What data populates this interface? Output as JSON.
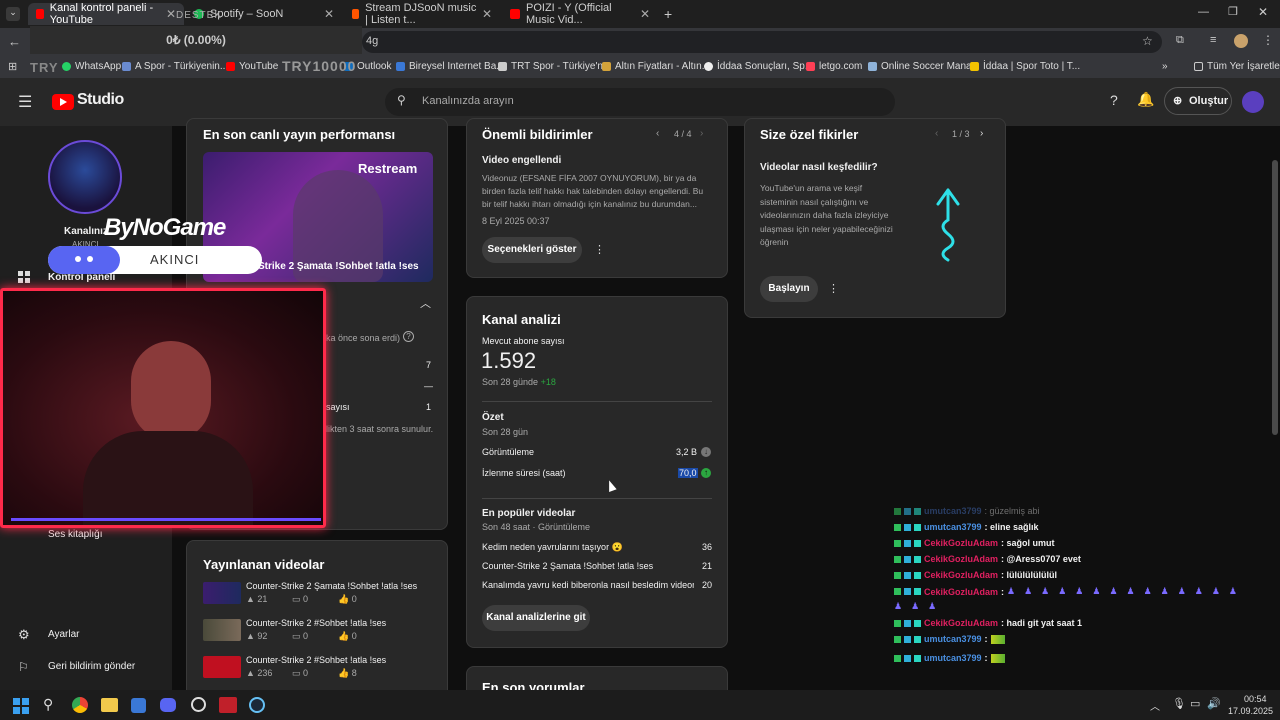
{
  "browser": {
    "tabs": [
      {
        "title": "Kanal kontrol paneli - YouTube",
        "active": true
      },
      {
        "title": "Spotify – SooN"
      },
      {
        "title": "Stream DJSooN music | Listen t..."
      },
      {
        "title": "POIZI - Y (Official Music Vid..."
      }
    ],
    "address_fragment": "4g",
    "bookmarks": [
      "WhatsApp",
      "A Spor - Türkiyenin...",
      "YouTube",
      "Outlook",
      "Bireysel Internet Ba...",
      "TRT Spor - Türkiye'n...",
      "Altın Fiyatları - Altın...",
      "İddaa Sonuçları, Sp...",
      "letgo.com",
      "Online Soccer Mana...",
      "İddaa | Spor Toto | T..."
    ],
    "all_bookmarks": "Tüm Yer İşaretleri"
  },
  "overlay": {
    "donation_text": "0₺ (0.00%)",
    "goal_text": "TRY10000",
    "brand": "ByNoGame",
    "name": "AKINCI",
    "restream_label": "Restream",
    "label_top": "DESTEK",
    "label_left": "TRY"
  },
  "header": {
    "logo_text": "Studio",
    "search_placeholder": "Kanalınızda arayın",
    "create_label": "Oluştur"
  },
  "sidebar": {
    "channel_label": "Kanalınız",
    "channel_name": "AKINCI",
    "items": {
      "dashboard": "Kontrol paneli",
      "audio": "Ses kitaplığı",
      "settings": "Ayarlar",
      "feedback": "Geri bildirim gönder"
    }
  },
  "live_card": {
    "title": "En son canlı yayın performansı",
    "video_title": "Strike 2 Şamata !Sohbet !atla !ses",
    "ended_text": "ka önce sona erdi)",
    "stats": {
      "row1": "7",
      "row2": "—",
      "row3_label": "sayısı",
      "row3": "1"
    },
    "note": "likten 3 saat sonra sunulur."
  },
  "published_card": {
    "title": "Yayınlanan videolar",
    "videos": [
      {
        "title": "Counter-Strike 2 Şamata !Sohbet !atla !ses",
        "views": "21",
        "comments": "0",
        "likes": "0"
      },
      {
        "title": "Counter-Strike 2 #Sohbet !atla !ses",
        "views": "92",
        "comments": "0",
        "likes": "0"
      },
      {
        "title": "Counter-Strike 2 #Sohbet !atla !ses",
        "views": "236",
        "comments": "0",
        "likes": "8"
      }
    ]
  },
  "notifications": {
    "title": "Önemli bildirimler",
    "pager": "4 / 4",
    "item_title": "Video engellendi",
    "item_body": "Videonuz (EFSANE FİFA 2007 OYNUYORUM), bir ya da birden fazla telif hakkı hak talebinden dolayı engellendi. Bu bir telif hakkı ihtarı olmadığı için kanalınız bu durumdan...",
    "item_date": "8 Eyl 2025 00:37",
    "button": "Seçenekleri göster"
  },
  "analytics": {
    "title": "Kanal analizi",
    "subs_label": "Mevcut abone sayısı",
    "subs_value": "1.592",
    "subs_delta_label": "Son 28 günde",
    "subs_delta": "+18",
    "summary_title": "Özet",
    "summary_period": "Son 28 gün",
    "views_label": "Görüntüleme",
    "views_value": "3,2 B",
    "watch_label": "İzlenme süresi (saat)",
    "watch_value": "70,0",
    "popular_title": "En popüler videolar",
    "popular_period": "Son 48 saat · Görüntüleme",
    "popular": [
      {
        "title": "Kedim neden yavrularını taşıyor 😮",
        "value": "36"
      },
      {
        "title": "Counter-Strike 2 Şamata !Sohbet !atla !ses",
        "value": "21"
      },
      {
        "title": "Kanalımda yavru kedi biberonla nasıl besledim videom...",
        "value": "20"
      }
    ],
    "button": "Kanal analizlerine git",
    "next_section": "En son yorumlar"
  },
  "ideas": {
    "title": "Size özel fikirler",
    "pager": "1 / 3",
    "question": "Videolar nasıl keşfedilir?",
    "body": "YouTube'un arama ve keşif sisteminin nasıl çalıştığını ve videolarınızın daha fazla izleyiciye ulaşması için neler yapabileceğinizi öğrenin",
    "button": "Başlayın"
  },
  "chat": [
    {
      "user": "umutcan3799",
      "msg": ": güzelmiş abi",
      "color": "#3a5a9a"
    },
    {
      "user": "umutcan3799",
      "msg": ": eline sağlık",
      "color": "#4a90e2"
    },
    {
      "user": "CekikGozluAdam",
      "msg": ": sağol umut",
      "color": "#e02060"
    },
    {
      "user": "CekikGozluAdam",
      "msg": ": @Aress0707 evet",
      "color": "#e02060"
    },
    {
      "user": "CekikGozluAdam",
      "msg": ": lülülülülülül",
      "color": "#e02060"
    },
    {
      "user": "CekikGozluAdam",
      "msg": ":",
      "color": "#e02060"
    },
    {
      "user": "CekikGozluAdam",
      "msg": ": hadi git yat saat 1",
      "color": "#e02060"
    },
    {
      "user": "umutcan3799",
      "msg": ":",
      "color": "#4a90e2"
    },
    {
      "user": "umutcan3799",
      "msg": ":",
      "color": "#4a90e2"
    }
  ],
  "taskbar": {
    "time": "00:54",
    "date": "17.09.2025"
  }
}
